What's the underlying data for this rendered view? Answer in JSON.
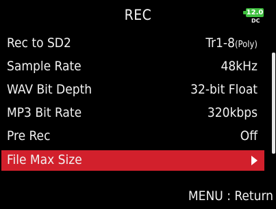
{
  "header": {
    "title": "REC",
    "battery": {
      "voltage": "12.0",
      "source": "DC",
      "color": "#3fbf3f"
    }
  },
  "menu": {
    "items": [
      {
        "label": "Rec to SD2",
        "value_main": "Tr1-8",
        "value_suffix": "(Poly)"
      },
      {
        "label": "Sample Rate",
        "value_main": "48kHz",
        "value_suffix": ""
      },
      {
        "label": "WAV Bit Depth",
        "value_main": "32-bit Float",
        "value_suffix": ""
      },
      {
        "label": "MP3 Bit Rate",
        "value_main": "320kbps",
        "value_suffix": ""
      },
      {
        "label": "Pre Rec",
        "value_main": "Off",
        "value_suffix": ""
      },
      {
        "label": "File Max Size",
        "value_main": "",
        "value_suffix": "",
        "selected": true,
        "icon": "submenu-arrow-icon"
      }
    ],
    "selected_color": "#d2202c"
  },
  "footer": {
    "hint": "MENU : Return"
  }
}
